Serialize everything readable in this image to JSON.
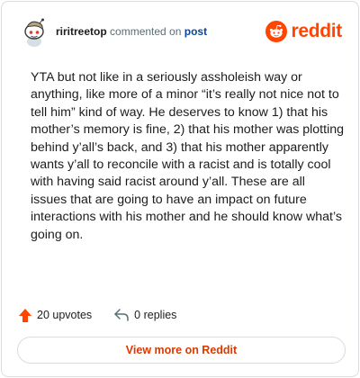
{
  "header": {
    "username": "riritreetop",
    "verb": "commented on",
    "post_link": "post",
    "logo_text": "reddit"
  },
  "comment": {
    "text": "YTA but not like in a seriously assholeish way or anything, like more of a minor “it’s really not nice not to tell him” kind of way. He deserves to know 1) that his mother’s memory is fine, 2) that his mother was plotting behind y’all’s back, and 3) that his mother apparently wants y’all to reconcile with a racist and is totally cool with having said racist around y’all. These are all issues that are going to have an impact on future interactions with his mother and he should know what’s going on."
  },
  "footer": {
    "upvotes": "20 upvotes",
    "replies": "0 replies",
    "view_more": "View more on Reddit"
  },
  "colors": {
    "brand": "#ff4500",
    "link": "#0a449b",
    "button_text": "#d93a00",
    "border": "#d9dde1"
  },
  "icons": {
    "avatar": "snoo-avatar",
    "logo": "reddit-snoo-icon",
    "upvote": "upvote-arrow-icon",
    "reply": "reply-arrow-icon"
  }
}
